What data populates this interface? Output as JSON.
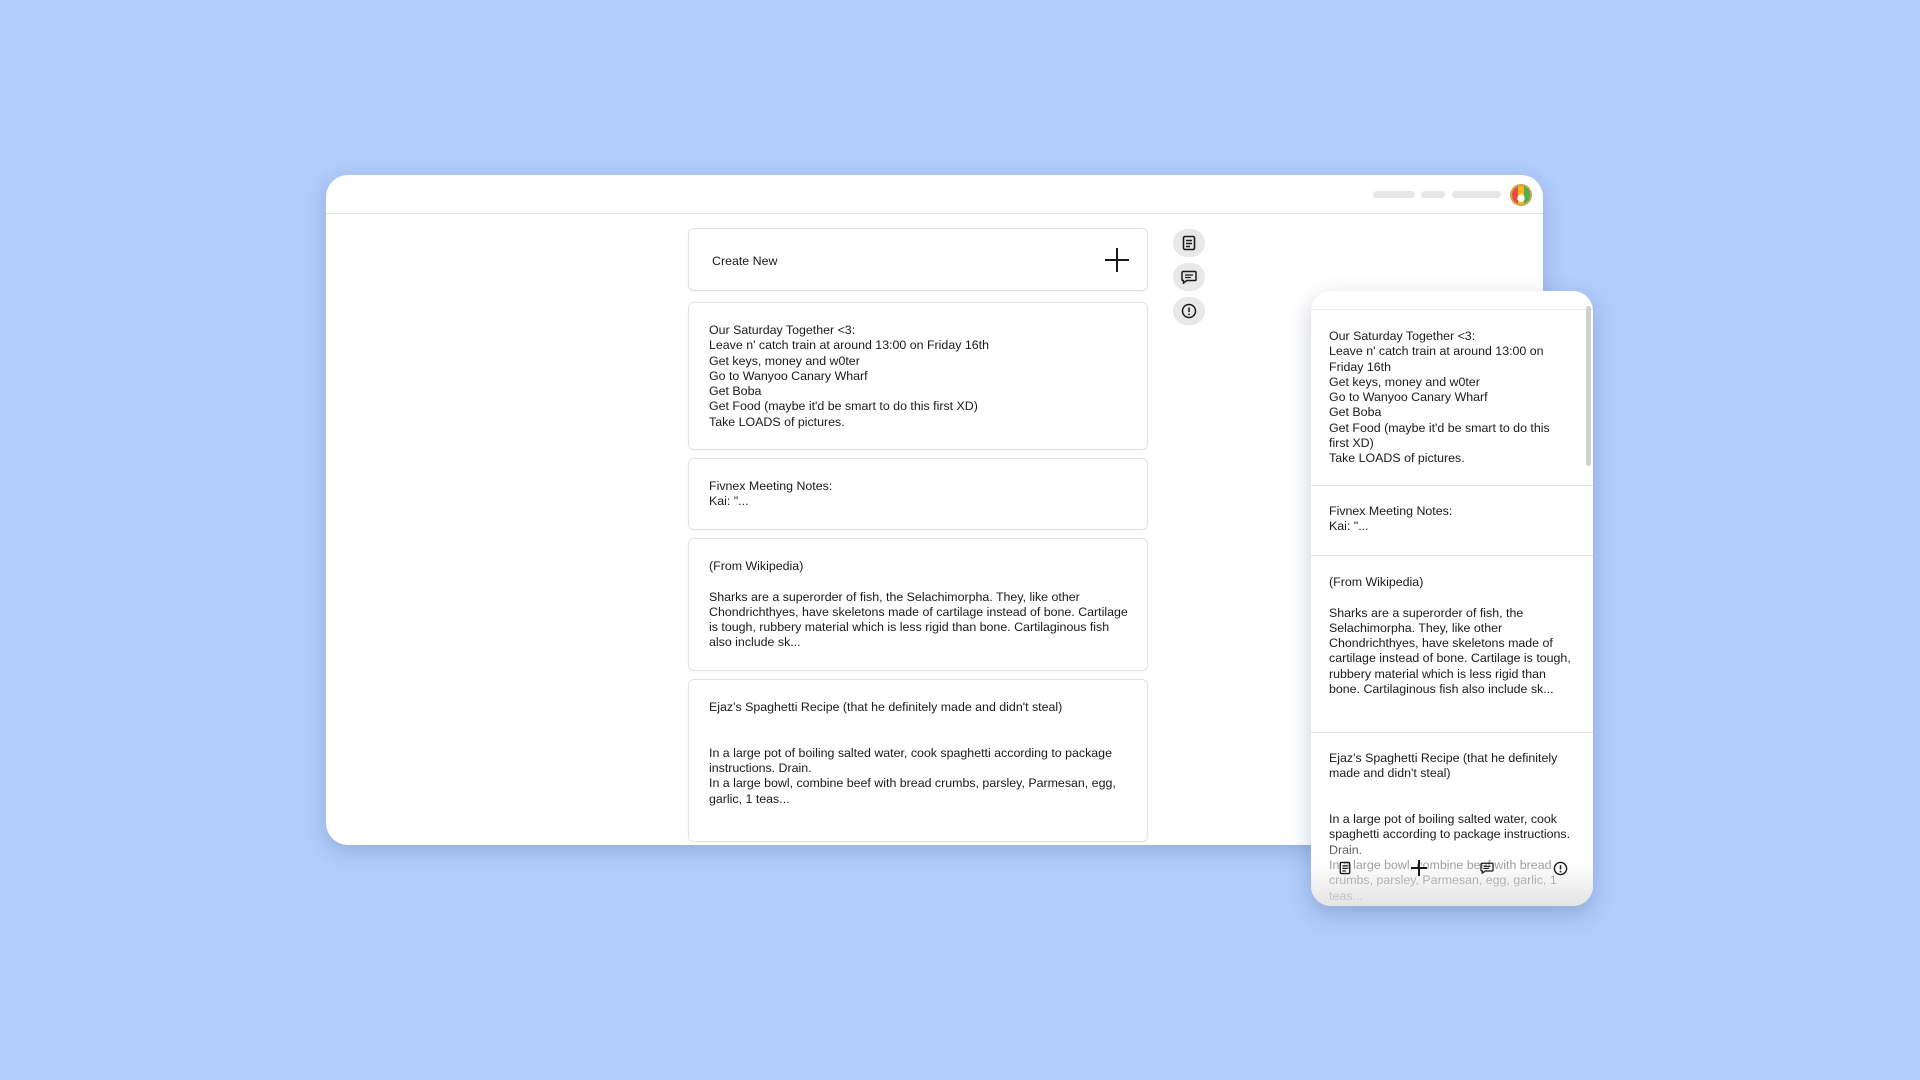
{
  "app": {
    "create_label": "Create New",
    "notes": [
      {
        "text": "Our Saturday Together <3:\nLeave n' catch train at around 13:00 on Friday 16th\nGet keys, money and w0ter\nGo to Wanyoo Canary Wharf\nGet Boba\nGet Food (maybe it'd be smart to do this first XD)\nTake LOADS of pictures."
      },
      {
        "text": "Fivnex Meeting Notes:\nKai: \"..."
      },
      {
        "text": "(From Wikipedia)\n\nSharks are a superorder of fish, the Selachimorpha. They, like other Chondrichthyes, have skeletons made of cartilage instead of bone. Cartilage is tough, rubbery material which is less rigid than bone. Cartilaginous fish also include sk..."
      },
      {
        "text": "Ejaz's Spaghetti Recipe (that he definitely made and didn't steal)\n\n\nIn a large pot of boiling salted water, cook spaghetti according to package instructions. Drain.\nIn a large bowl, combine beef with bread crumbs, parsley, Parmesan, egg, garlic, 1 teas..."
      }
    ]
  },
  "mobile": {
    "notes": [
      {
        "text": "Our Saturday Together <3:\nLeave n' catch train at around 13:00 on Friday 16th\nGet keys, money and w0ter\nGo to Wanyoo Canary Wharf\nGet Boba\nGet Food (maybe it'd be smart to do this first XD)\nTake LOADS of pictures."
      },
      {
        "text": "Fivnex Meeting Notes:\nKai: \"..."
      },
      {
        "text": "(From Wikipedia)\n\nSharks are a superorder of fish, the Selachimorpha. They, like other Chondrichthyes, have skeletons made of cartilage instead of bone. Cartilage is tough, rubbery material which is less rigid than bone. Cartilaginous fish also include sk..."
      },
      {
        "text": "Ejaz's Spaghetti Recipe (that he definitely made and didn't steal)\n\n\nIn a large pot of boiling salted water, cook spaghetti according to package instructions. Drain.\nIn a large bowl, combine beef with bread crumbs, parsley, Parmesan, egg, garlic, 1 teas..."
      }
    ]
  },
  "icons": {
    "side": [
      "notes-icon",
      "message-icon",
      "info-icon"
    ],
    "mobile_nav": [
      "notes-icon",
      "plus-icon",
      "message-icon",
      "info-icon"
    ]
  },
  "colors": {
    "background": "#b1cdfb",
    "surface": "#ffffff",
    "border": "#e2e2e2",
    "text": "#1a1a1a"
  }
}
